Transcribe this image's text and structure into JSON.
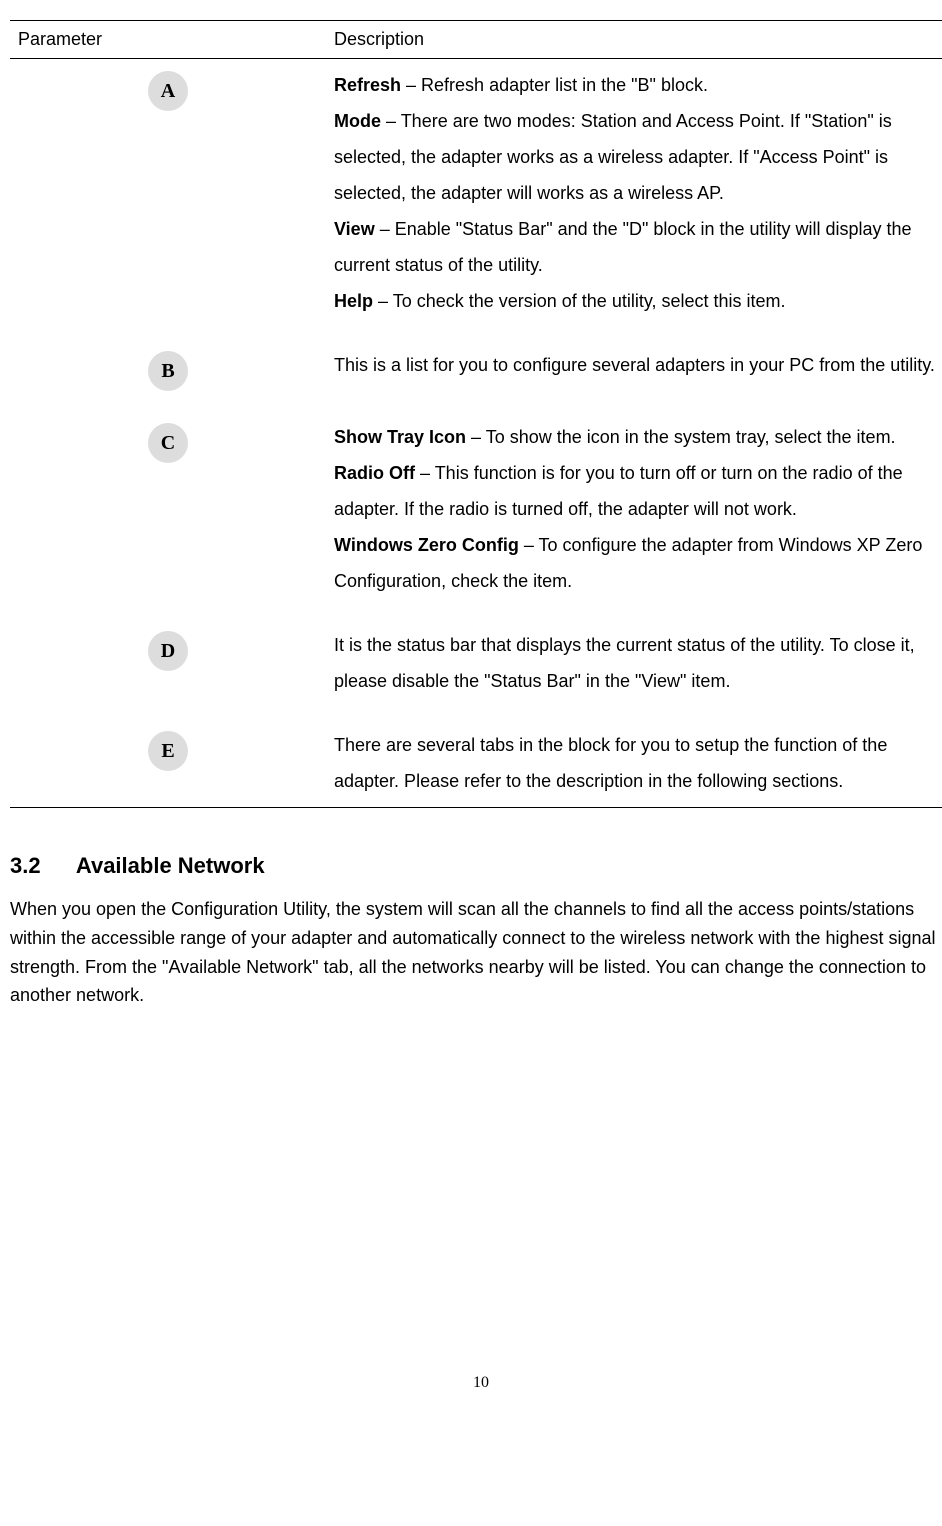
{
  "table": {
    "headers": {
      "param": "Parameter",
      "desc": "Description"
    },
    "rows": [
      {
        "badge": "A",
        "items": [
          {
            "label": "Refresh",
            "text": " – Refresh adapter list in the \"B\" block."
          },
          {
            "label": "Mode",
            "text": " – There are two modes: Station and Access Point. If \"Station\" is selected, the adapter works as a wireless adapter. If \"Access Point\" is selected, the adapter will works as a wireless AP."
          },
          {
            "label": "View",
            "text": " – Enable \"Status Bar\" and the \"D\" block in the utility will display the current status of the utility."
          },
          {
            "label": "Help",
            "text": " – To check the version of the utility, select this item."
          }
        ]
      },
      {
        "badge": "B",
        "items": [
          {
            "label": "",
            "text": "This is a list for you to configure several adapters in your PC from the utility."
          }
        ]
      },
      {
        "badge": "C",
        "items": [
          {
            "label": "Show Tray Icon",
            "text": " – To show the icon in the system tray, select the item."
          },
          {
            "label": "Radio Off",
            "text": " – This function is for you to turn off or turn on the radio of the adapter. If the radio is turned off, the adapter will not work."
          },
          {
            "label": "Windows Zero Config",
            "text": " – To configure the adapter from Windows XP Zero Configuration, check the item."
          }
        ]
      },
      {
        "badge": "D",
        "items": [
          {
            "label": "",
            "text": "It is the status bar that displays the current status of the utility. To close it, please disable the \"Status Bar\" in the \"View\" item."
          }
        ]
      },
      {
        "badge": "E",
        "items": [
          {
            "label": "",
            "text": "There are several tabs in the block for you to setup the function of the adapter. Please refer to the description in the following sections."
          }
        ]
      }
    ]
  },
  "section": {
    "num": "3.2",
    "title": "Available Network",
    "body": "When you open the Configuration Utility, the system will scan all the channels to find all the access points/stations within the accessible range of your adapter and automatically connect to the wireless network with the highest signal strength. From the \"Available Network\" tab, all the networks nearby will be listed. You can change the connection to another network."
  },
  "page": "10"
}
